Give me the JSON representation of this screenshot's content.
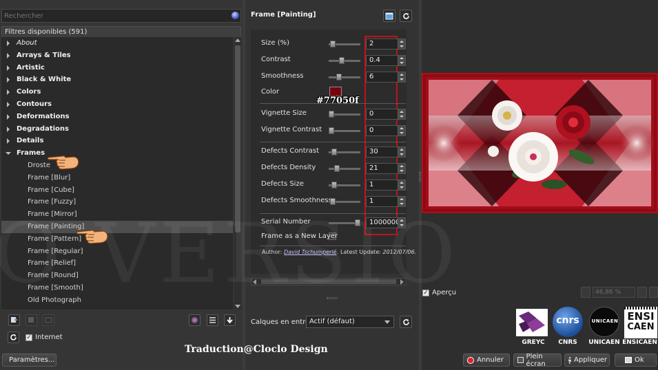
{
  "search": {
    "placeholder": "Rechercher"
  },
  "filters": {
    "header": "Filtres disponibles (591)",
    "categories": [
      {
        "label": "About",
        "italic": true
      },
      {
        "label": "Arrays & Tiles"
      },
      {
        "label": "Artistic"
      },
      {
        "label": "Black & White"
      },
      {
        "label": "Colors"
      },
      {
        "label": "Contours"
      },
      {
        "label": "Deformations"
      },
      {
        "label": "Degradations"
      },
      {
        "label": "Details"
      },
      {
        "label": "Frames",
        "open": true
      }
    ],
    "frames_items": [
      "Droste",
      "Frame [Blur]",
      "Frame [Cube]",
      "Frame [Fuzzy]",
      "Frame [Mirror]",
      "Frame [Painting]",
      "Frame [Pattern]",
      "Frame [Regular]",
      "Frame [Relief]",
      "Frame [Round]",
      "Frame [Smooth]",
      "Old Photograph"
    ],
    "selected": "Frame [Painting]"
  },
  "left_bottom": {
    "internet_label": "Internet",
    "params_button": "Paramètres..."
  },
  "filter": {
    "title": "Frame [Painting]",
    "params": [
      {
        "label": "Size (%)",
        "value": "2",
        "level": 0.05
      },
      {
        "label": "Contrast",
        "value": "0.4",
        "level": 0.4
      },
      {
        "label": "Smoothness",
        "value": "6",
        "level": 0.3
      },
      {
        "label": "Color",
        "value": ""
      },
      {
        "label": "Vignette Size",
        "value": "0",
        "level": 0
      },
      {
        "label": "Vignette Contrast",
        "value": "0",
        "level": 0
      },
      {
        "label": "Defects Contrast",
        "value": "30",
        "level": 0.1
      },
      {
        "label": "Defects Density",
        "value": "21",
        "level": 0.2
      },
      {
        "label": "Defects Size",
        "value": "1",
        "level": 0.1
      },
      {
        "label": "Defects Smoothness",
        "value": "1",
        "level": 0.05
      },
      {
        "label": "Serial Number",
        "value": "1000000",
        "level": 1.0
      },
      {
        "label": "Frame as a New Layer",
        "value": ""
      }
    ],
    "color_hex": "#77050f",
    "color_annotation": "#77050f",
    "author_prefix": "Author:",
    "author_name": "David Tschumperlé",
    "author_suffix": ".",
    "latest_update_label": "Latest Update:",
    "latest_update_value": "2012/07/06."
  },
  "layers": {
    "label": "Calques en entrée",
    "value": "Actif (défaut)"
  },
  "preview": {
    "apercu_label": "Aperçu",
    "zoom_value": "46,86 %"
  },
  "logos": [
    "GREYC",
    "CNRS",
    "UNICAEN",
    "ENSICAEN"
  ],
  "logo_texts": {
    "cnrs": "cnrs",
    "unicaen": "UNICAEN",
    "ensi_top": "ENSI",
    "ensi_bottom": "CAEN"
  },
  "buttons": {
    "annuler": "Annuler",
    "plein_ecran": "Plein écran",
    "appliquer": "Appliquer",
    "ok": "Ok"
  },
  "overlay": {
    "credit": "Traduction@Cloclo Design",
    "watermark": "O VERSIO"
  },
  "colors": {
    "accent_red": "#c0121a",
    "preview_red": "#8e0a12"
  }
}
